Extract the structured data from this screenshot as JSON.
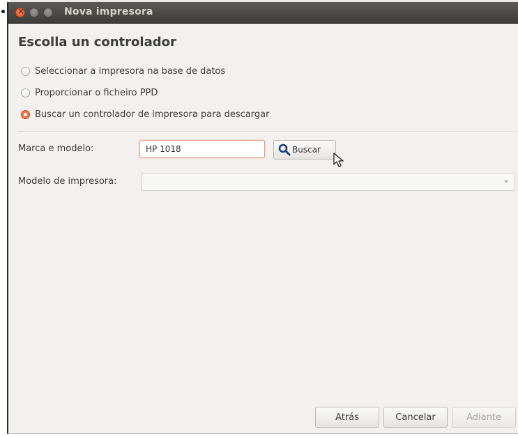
{
  "window": {
    "title": "Nova impresora"
  },
  "page": {
    "heading": "Escolla un controlador"
  },
  "options": [
    {
      "label": "Seleccionar a impresora na base de datos",
      "checked": false
    },
    {
      "label": "Proporcionar o ficheiro PPD",
      "checked": false
    },
    {
      "label": "Buscar un controlador de impresora para descargar",
      "checked": true
    }
  ],
  "search": {
    "make_model_label": "Marca e modelo:",
    "make_model_value": "HP 1018",
    "search_button_label": "Buscar"
  },
  "printer_model": {
    "label": "Modelo de impresora:",
    "selected": ""
  },
  "footer": {
    "back_label": "Atrás",
    "cancel_label": "Cancelar",
    "forward_label": "Adiante"
  },
  "colors": {
    "accent": "#f07746",
    "titlebar": "#3e3d39",
    "window_bg": "#f2f1f0"
  },
  "icons": [
    "close-icon",
    "minimize-icon",
    "maximize-icon",
    "search-icon",
    "chevron-down-icon",
    "mouse-pointer-icon"
  ]
}
